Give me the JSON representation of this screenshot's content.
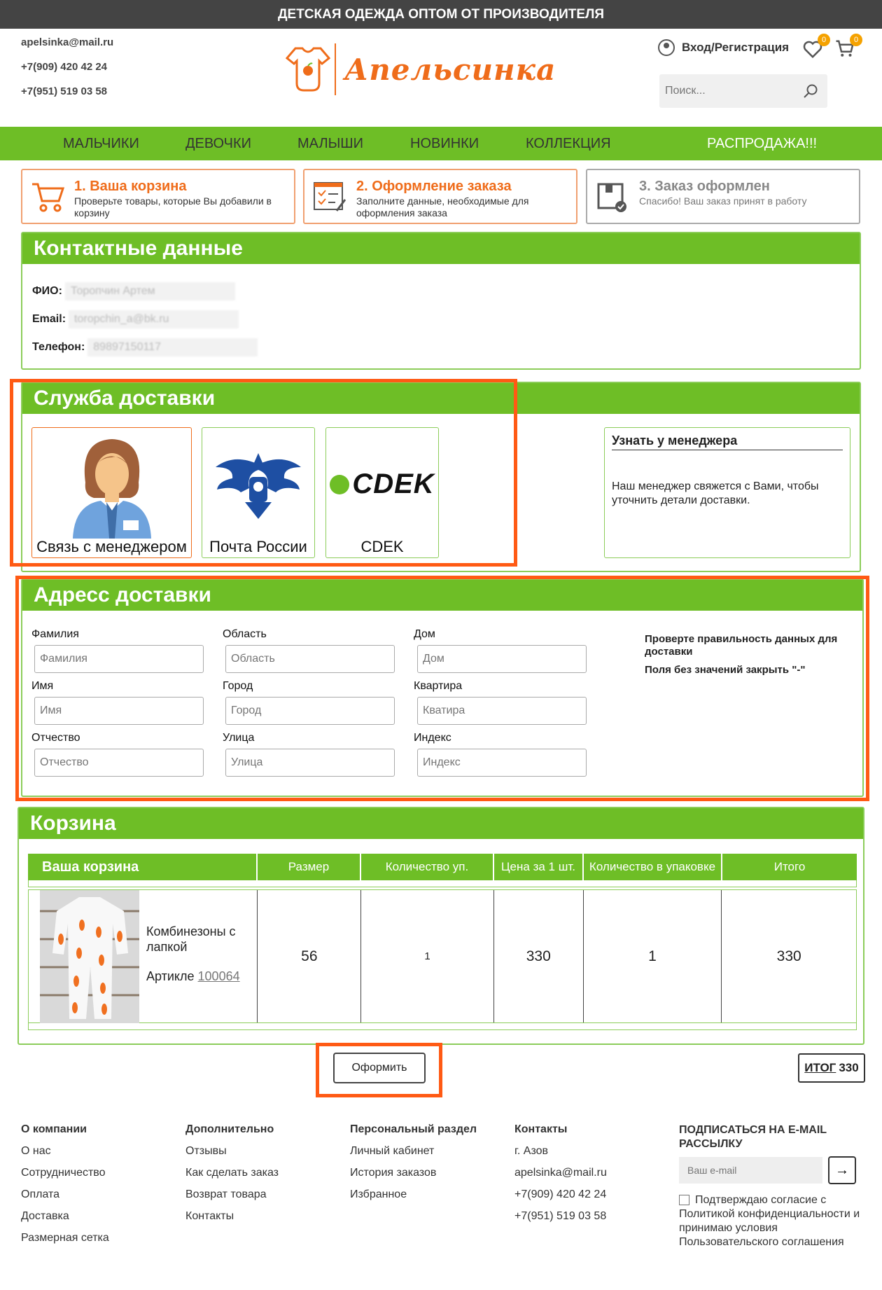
{
  "topbar": {
    "text": "ДЕТСКАЯ ОДЕЖДА ОПТОМ ОТ ПРОИЗВОДИТЕЛЯ"
  },
  "header": {
    "email": "apelsinka@mail.ru",
    "phone1": "+7(909) 420 42 24",
    "phone2": "+7(951) 519 03 58",
    "logo_text": "Апельсинка",
    "login": "Вход/Регистрация",
    "wishlist_count": "0",
    "cart_count": "0",
    "search_placeholder": "Поиск..."
  },
  "nav": [
    "МАЛЬЧИКИ",
    "ДЕВОЧКИ",
    "МАЛЫШИ",
    "НОВИНКИ",
    "КОЛЛЕКЦИЯ",
    "РАСПРОДАЖА!!!"
  ],
  "steps": [
    {
      "title": "1. Ваша корзина",
      "desc": "Проверьте товары, которые Вы добавили в корзину"
    },
    {
      "title": "2. Оформление заказа",
      "desc": "Заполните данные, необходимые для оформления заказа"
    },
    {
      "title": "3. Заказ оформлен",
      "desc": "Спасибо! Ваш заказ принят в работу"
    }
  ],
  "contact": {
    "title": "Контактные данные",
    "fio_label": "ФИО:",
    "fio": "Торопчин Артем",
    "email_label": "Email:",
    "email": "toropchin_a@bk.ru",
    "phone_label": "Телефон:",
    "phone": "89897150117"
  },
  "delivery": {
    "title": "Служба доставки",
    "options": [
      "Связь с менеджером",
      "Почта России",
      "CDEK"
    ],
    "cdek_logo": "CDEK",
    "info_title": "Узнать у менеджера",
    "info_text": "Наш менеджер свяжется с Вами, чтобы уточнить детали доставки."
  },
  "address": {
    "title": "Адресс доставки",
    "fields": {
      "lastname": {
        "label": "Фамилия",
        "placeholder": "Фамилия"
      },
      "firstname": {
        "label": "Имя",
        "placeholder": "Имя"
      },
      "middlename": {
        "label": "Отчество",
        "placeholder": "Отчество"
      },
      "region": {
        "label": "Область",
        "placeholder": "Область"
      },
      "city": {
        "label": "Город",
        "placeholder": "Город"
      },
      "street": {
        "label": "Улица",
        "placeholder": "Улица"
      },
      "house": {
        "label": "Дом",
        "placeholder": "Дом"
      },
      "apt": {
        "label": "Квартира",
        "placeholder": "Кватира"
      },
      "zip": {
        "label": "Индекс",
        "placeholder": "Индекс"
      }
    },
    "note1": "Проверте правильность данных для доставки",
    "note2": "Поля без значений закрыть \"-\""
  },
  "cart": {
    "title": "Корзина",
    "columns": [
      "Ваша корзина",
      "Размер",
      "Количество уп.",
      "Цена за 1 шт.",
      "Количество в упаковке",
      "Итого"
    ],
    "item": {
      "name": "Комбинезоны с лапкой",
      "article_label": "Артикле",
      "article": "100064",
      "size": "56",
      "packs": "1",
      "price": "330",
      "per_pack": "1",
      "total": "330"
    }
  },
  "checkout_button": "Оформить",
  "grand_total": {
    "label": "ИТОГ",
    "value": "330"
  },
  "footer": {
    "col1": {
      "title": "О компании",
      "items": [
        "О нас",
        "Сотрудничество",
        "Оплата",
        "Доставка",
        "Размерная сетка"
      ]
    },
    "col2": {
      "title": "Дополнительно",
      "items": [
        "Отзывы",
        "Как сделать заказ",
        "Возврат товара",
        "Контакты"
      ]
    },
    "col3": {
      "title": "Персональный раздел",
      "items": [
        "Личный кабинет",
        "История заказов",
        "Избранное"
      ]
    },
    "col4": {
      "title": "Контакты",
      "items": [
        "г. Азов",
        "apelsinka@mail.ru",
        "+7(909) 420 42 24",
        "+7(951) 519 03 58"
      ]
    },
    "subscribe_title": "ПОДПИСАТЬСЯ НА E-MAIL РАССЫЛКУ",
    "subscribe_placeholder": "Ваш e-mail",
    "agree": "Подтверждаю согласие с Политикой конфиденциальности и принимаю условия Пользовательского соглашения"
  },
  "colors": {
    "green": "#6ebe26",
    "orange": "#ef6c1a",
    "highlight": "#ff5a14"
  }
}
